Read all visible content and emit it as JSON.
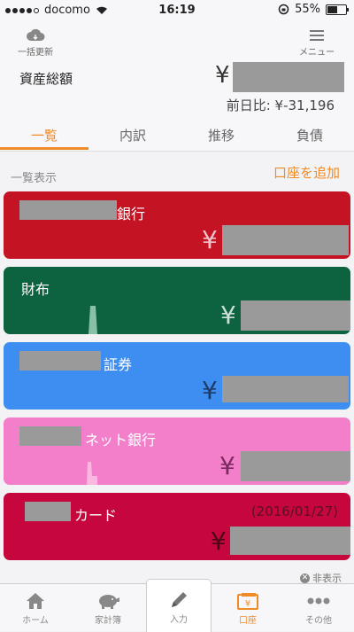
{
  "status_bar": {
    "carrier": "docomo",
    "time": "16:19",
    "battery": "55%"
  },
  "header": {
    "refresh_label": "一括更新",
    "menu_label": "メニュー",
    "total_label": "資産総額",
    "currency": "¥",
    "prev_day": "前日比: ¥-31,196"
  },
  "tabs": [
    {
      "label": "一覧"
    },
    {
      "label": "内訳"
    },
    {
      "label": "推移"
    },
    {
      "label": "負債"
    }
  ],
  "section_title": "一覧表示",
  "add_account": "口座を追加",
  "accounts": [
    {
      "name": "銀行",
      "currency": "¥",
      "color": "#c41424",
      "date": ""
    },
    {
      "name": "財布",
      "currency": "¥",
      "color": "#0d6340",
      "date": ""
    },
    {
      "name": "証券",
      "currency": "¥",
      "color": "#3d8ef0",
      "date": ""
    },
    {
      "name": "ネット銀行",
      "currency": "¥",
      "color": "#f37fcb",
      "date": ""
    },
    {
      "name": "カード",
      "currency": "¥",
      "color": "#c5073d",
      "date": "(2016/01/27)"
    }
  ],
  "hide_label": "非表示",
  "tabbar": [
    {
      "label": "ホーム",
      "icon": "home-icon"
    },
    {
      "label": "家計簿",
      "icon": "piggy-bank-icon"
    },
    {
      "label": "入力",
      "icon": "pencil-icon"
    },
    {
      "label": "口座",
      "icon": "wallet-icon"
    },
    {
      "label": "その他",
      "icon": "more-icon"
    }
  ]
}
